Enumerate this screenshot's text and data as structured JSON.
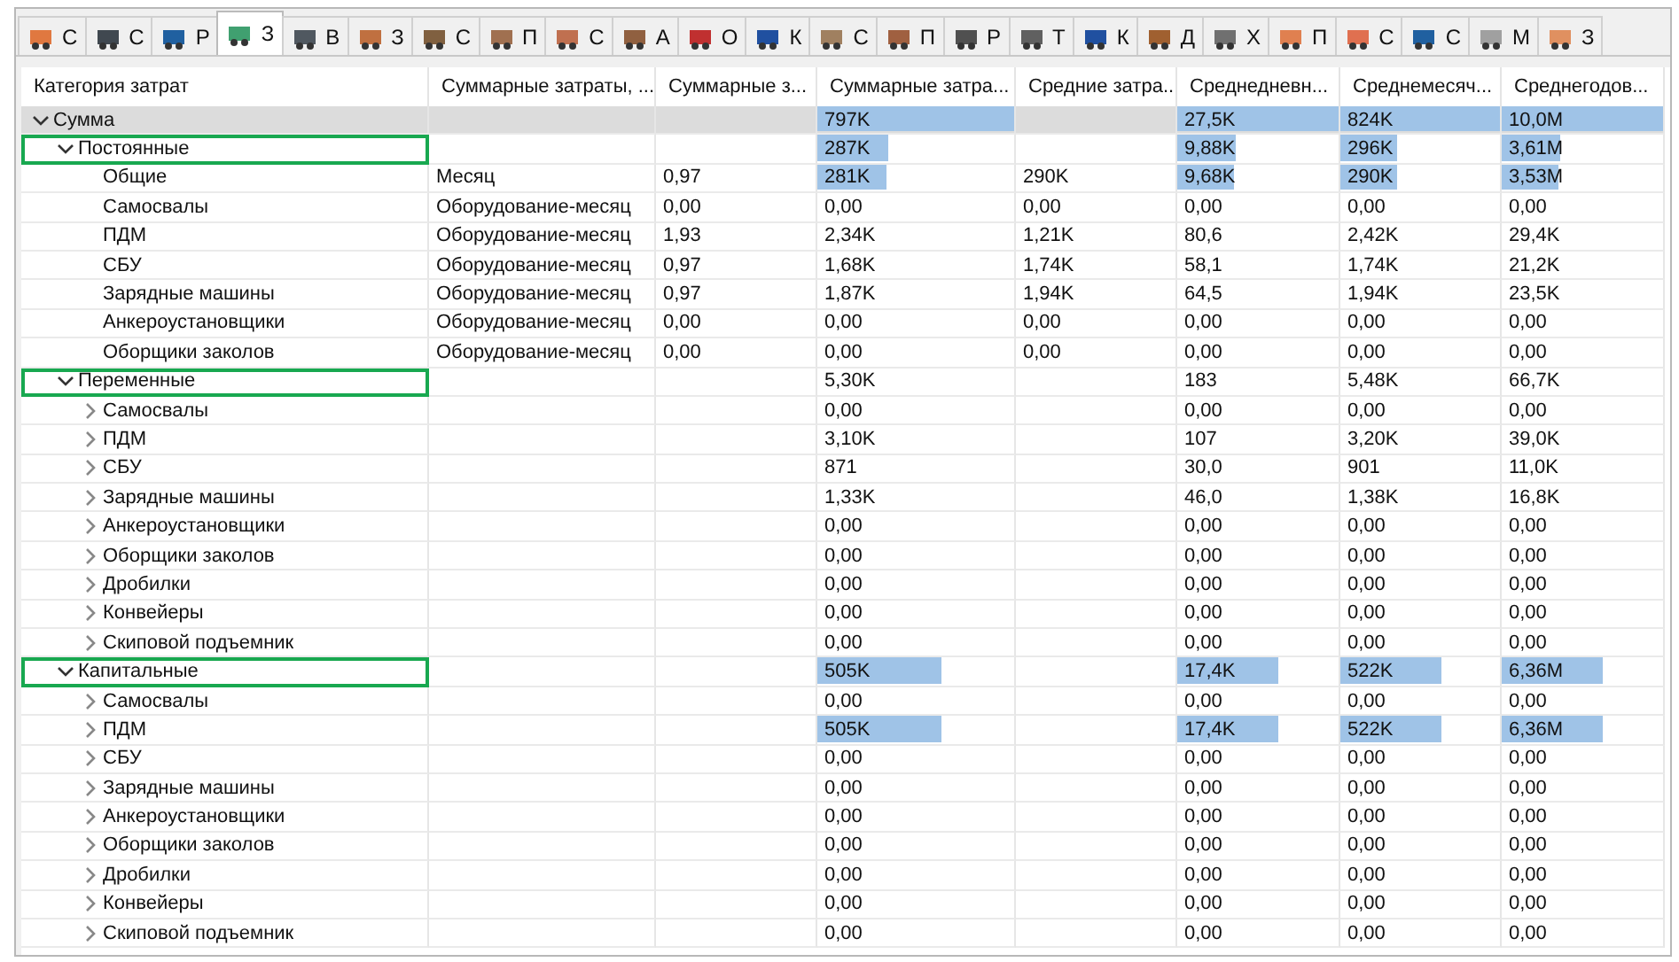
{
  "tabs": [
    {
      "label": "С",
      "selected": false
    },
    {
      "label": "С",
      "selected": false
    },
    {
      "label": "Р",
      "selected": false
    },
    {
      "label": "З",
      "selected": true
    },
    {
      "label": "В",
      "selected": false
    },
    {
      "label": "З",
      "selected": false
    },
    {
      "label": "С",
      "selected": false
    },
    {
      "label": "П",
      "selected": false
    },
    {
      "label": "С",
      "selected": false
    },
    {
      "label": "А",
      "selected": false
    },
    {
      "label": "О",
      "selected": false
    },
    {
      "label": "К",
      "selected": false
    },
    {
      "label": "С",
      "selected": false
    },
    {
      "label": "П",
      "selected": false
    },
    {
      "label": "Р",
      "selected": false
    },
    {
      "label": "Т",
      "selected": false
    },
    {
      "label": "К",
      "selected": false
    },
    {
      "label": "Д",
      "selected": false
    },
    {
      "label": "Х",
      "selected": false
    },
    {
      "label": "П",
      "selected": false
    },
    {
      "label": "С",
      "selected": false
    },
    {
      "label": "С",
      "selected": false
    },
    {
      "label": "М",
      "selected": false
    },
    {
      "label": "З",
      "selected": false
    }
  ],
  "table": {
    "columns": [
      "Категория затрат",
      "Суммарные затраты, ...",
      "Суммарные з...",
      "Суммарные затра...",
      "Средние затра...",
      "Среднедневн...",
      "Среднемесяч...",
      "Среднегодов..."
    ],
    "rows": [
      {
        "selected": true,
        "expanded": true,
        "highlighted": false,
        "cells": [
          {
            "text": "Сумма"
          },
          null,
          null,
          {
            "text": "797K",
            "level": 1
          },
          null,
          {
            "text": "27,5K",
            "level": 1
          },
          {
            "text": "824K",
            "level": 1
          },
          {
            "text": "10,0M",
            "level": 1
          }
        ],
        "children": [
          {
            "selected": false,
            "expanded": true,
            "highlighted": true,
            "cells": [
              {
                "text": "Постоянные"
              },
              null,
              null,
              {
                "text": "287K",
                "level": 0.36
              },
              null,
              {
                "text": "9,88K",
                "level": 0.36
              },
              {
                "text": "296K",
                "level": 0.36
              },
              {
                "text": "3,61M",
                "level": 0.36
              }
            ],
            "children": [
              {
                "selected": false,
                "cells": [
                  {
                    "text": "Общие"
                  },
                  {
                    "text": "Месяц"
                  },
                  {
                    "text": "0,97"
                  },
                  {
                    "text": "281K",
                    "level": 0.35
                  },
                  {
                    "text": "290K"
                  },
                  {
                    "text": "9,68K",
                    "level": 0.35
                  },
                  {
                    "text": "290K",
                    "level": 0.35
                  },
                  {
                    "text": "3,53M",
                    "level": 0.35
                  }
                ]
              },
              {
                "selected": false,
                "cells": [
                  {
                    "text": "Самосвалы"
                  },
                  {
                    "text": "Оборудование-месяц"
                  },
                  {
                    "text": "0,00"
                  },
                  {
                    "text": "0,00"
                  },
                  {
                    "text": "0,00"
                  },
                  {
                    "text": "0,00"
                  },
                  {
                    "text": "0,00"
                  },
                  {
                    "text": "0,00"
                  }
                ]
              },
              {
                "selected": false,
                "cells": [
                  {
                    "text": "ПДМ"
                  },
                  {
                    "text": "Оборудование-месяц"
                  },
                  {
                    "text": "1,93"
                  },
                  {
                    "text": "2,34K"
                  },
                  {
                    "text": "1,21K"
                  },
                  {
                    "text": "80,6"
                  },
                  {
                    "text": "2,42K"
                  },
                  {
                    "text": "29,4K"
                  }
                ]
              },
              {
                "selected": false,
                "cells": [
                  {
                    "text": "СБУ"
                  },
                  {
                    "text": "Оборудование-месяц"
                  },
                  {
                    "text": "0,97"
                  },
                  {
                    "text": "1,68K"
                  },
                  {
                    "text": "1,74K"
                  },
                  {
                    "text": "58,1"
                  },
                  {
                    "text": "1,74K"
                  },
                  {
                    "text": "21,2K"
                  }
                ]
              },
              {
                "selected": false,
                "cells": [
                  {
                    "text": "Зарядные машины"
                  },
                  {
                    "text": "Оборудование-месяц"
                  },
                  {
                    "text": "0,97"
                  },
                  {
                    "text": "1,87K"
                  },
                  {
                    "text": "1,94K"
                  },
                  {
                    "text": "64,5"
                  },
                  {
                    "text": "1,94K"
                  },
                  {
                    "text": "23,5K"
                  }
                ]
              },
              {
                "selected": false,
                "cells": [
                  {
                    "text": "Анкероустановщики"
                  },
                  {
                    "text": "Оборудование-месяц"
                  },
                  {
                    "text": "0,00"
                  },
                  {
                    "text": "0,00"
                  },
                  {
                    "text": "0,00"
                  },
                  {
                    "text": "0,00"
                  },
                  {
                    "text": "0,00"
                  },
                  {
                    "text": "0,00"
                  }
                ]
              },
              {
                "selected": false,
                "cells": [
                  {
                    "text": "Оборщики заколов"
                  },
                  {
                    "text": "Оборудование-месяц"
                  },
                  {
                    "text": "0,00"
                  },
                  {
                    "text": "0,00"
                  },
                  {
                    "text": "0,00"
                  },
                  {
                    "text": "0,00"
                  },
                  {
                    "text": "0,00"
                  },
                  {
                    "text": "0,00"
                  }
                ]
              }
            ]
          },
          {
            "selected": false,
            "expanded": true,
            "highlighted": true,
            "cells": [
              {
                "text": "Переменные"
              },
              null,
              null,
              {
                "text": "5,30K"
              },
              null,
              {
                "text": "183"
              },
              {
                "text": "5,48K"
              },
              {
                "text": "66,7K"
              }
            ],
            "children": [
              {
                "selected": false,
                "expanded": false,
                "cells": [
                  {
                    "text": "Самосвалы"
                  },
                  null,
                  null,
                  {
                    "text": "0,00"
                  },
                  null,
                  {
                    "text": "0,00"
                  },
                  {
                    "text": "0,00"
                  },
                  {
                    "text": "0,00"
                  }
                ]
              },
              {
                "selected": false,
                "expanded": false,
                "cells": [
                  {
                    "text": "ПДМ"
                  },
                  null,
                  null,
                  {
                    "text": "3,10K"
                  },
                  null,
                  {
                    "text": "107"
                  },
                  {
                    "text": "3,20K"
                  },
                  {
                    "text": "39,0K"
                  }
                ]
              },
              {
                "selected": false,
                "expanded": false,
                "cells": [
                  {
                    "text": "СБУ"
                  },
                  null,
                  null,
                  {
                    "text": "871"
                  },
                  null,
                  {
                    "text": "30,0"
                  },
                  {
                    "text": "901"
                  },
                  {
                    "text": "11,0K"
                  }
                ]
              },
              {
                "selected": false,
                "expanded": false,
                "cells": [
                  {
                    "text": "Зарядные машины"
                  },
                  null,
                  null,
                  {
                    "text": "1,33K"
                  },
                  null,
                  {
                    "text": "46,0"
                  },
                  {
                    "text": "1,38K"
                  },
                  {
                    "text": "16,8K"
                  }
                ]
              },
              {
                "selected": false,
                "expanded": false,
                "cells": [
                  {
                    "text": "Анкероустановщики"
                  },
                  null,
                  null,
                  {
                    "text": "0,00"
                  },
                  null,
                  {
                    "text": "0,00"
                  },
                  {
                    "text": "0,00"
                  },
                  {
                    "text": "0,00"
                  }
                ]
              },
              {
                "selected": false,
                "expanded": false,
                "cells": [
                  {
                    "text": "Оборщики заколов"
                  },
                  null,
                  null,
                  {
                    "text": "0,00"
                  },
                  null,
                  {
                    "text": "0,00"
                  },
                  {
                    "text": "0,00"
                  },
                  {
                    "text": "0,00"
                  }
                ]
              },
              {
                "selected": false,
                "expanded": false,
                "cells": [
                  {
                    "text": "Дробилки"
                  },
                  null,
                  null,
                  {
                    "text": "0,00"
                  },
                  null,
                  {
                    "text": "0,00"
                  },
                  {
                    "text": "0,00"
                  },
                  {
                    "text": "0,00"
                  }
                ]
              },
              {
                "selected": false,
                "expanded": false,
                "cells": [
                  {
                    "text": "Конвейеры"
                  },
                  null,
                  null,
                  {
                    "text": "0,00"
                  },
                  null,
                  {
                    "text": "0,00"
                  },
                  {
                    "text": "0,00"
                  },
                  {
                    "text": "0,00"
                  }
                ]
              },
              {
                "selected": false,
                "expanded": false,
                "cells": [
                  {
                    "text": "Скиповой подъемник"
                  },
                  null,
                  null,
                  {
                    "text": "0,00"
                  },
                  null,
                  {
                    "text": "0,00"
                  },
                  {
                    "text": "0,00"
                  },
                  {
                    "text": "0,00"
                  }
                ]
              }
            ]
          },
          {
            "selected": false,
            "expanded": true,
            "highlighted": true,
            "cells": [
              {
                "text": "Капитальные"
              },
              null,
              null,
              {
                "text": "505K",
                "level": 0.63
              },
              null,
              {
                "text": "17,4K",
                "level": 0.63
              },
              {
                "text": "522K",
                "level": 0.63
              },
              {
                "text": "6,36M",
                "level": 0.63
              }
            ],
            "children": [
              {
                "selected": false,
                "expanded": false,
                "cells": [
                  {
                    "text": "Самосвалы"
                  },
                  null,
                  null,
                  {
                    "text": "0,00"
                  },
                  null,
                  {
                    "text": "0,00"
                  },
                  {
                    "text": "0,00"
                  },
                  {
                    "text": "0,00"
                  }
                ]
              },
              {
                "selected": false,
                "expanded": false,
                "cells": [
                  {
                    "text": "ПДМ"
                  },
                  null,
                  null,
                  {
                    "text": "505K",
                    "level": 0.63
                  },
                  null,
                  {
                    "text": "17,4K",
                    "level": 0.63
                  },
                  {
                    "text": "522K",
                    "level": 0.63
                  },
                  {
                    "text": "6,36M",
                    "level": 0.63
                  }
                ]
              },
              {
                "selected": false,
                "expanded": false,
                "cells": [
                  {
                    "text": "СБУ"
                  },
                  null,
                  null,
                  {
                    "text": "0,00"
                  },
                  null,
                  {
                    "text": "0,00"
                  },
                  {
                    "text": "0,00"
                  },
                  {
                    "text": "0,00"
                  }
                ]
              },
              {
                "selected": false,
                "expanded": false,
                "cells": [
                  {
                    "text": "Зарядные машины"
                  },
                  null,
                  null,
                  {
                    "text": "0,00"
                  },
                  null,
                  {
                    "text": "0,00"
                  },
                  {
                    "text": "0,00"
                  },
                  {
                    "text": "0,00"
                  }
                ]
              },
              {
                "selected": false,
                "expanded": false,
                "cells": [
                  {
                    "text": "Анкероустановщики"
                  },
                  null,
                  null,
                  {
                    "text": "0,00"
                  },
                  null,
                  {
                    "text": "0,00"
                  },
                  {
                    "text": "0,00"
                  },
                  {
                    "text": "0,00"
                  }
                ]
              },
              {
                "selected": false,
                "expanded": false,
                "cells": [
                  {
                    "text": "Оборщики заколов"
                  },
                  null,
                  null,
                  {
                    "text": "0,00"
                  },
                  null,
                  {
                    "text": "0,00"
                  },
                  {
                    "text": "0,00"
                  },
                  {
                    "text": "0,00"
                  }
                ]
              },
              {
                "selected": false,
                "expanded": false,
                "cells": [
                  {
                    "text": "Дробилки"
                  },
                  null,
                  null,
                  {
                    "text": "0,00"
                  },
                  null,
                  {
                    "text": "0,00"
                  },
                  {
                    "text": "0,00"
                  },
                  {
                    "text": "0,00"
                  }
                ]
              },
              {
                "selected": false,
                "expanded": false,
                "cells": [
                  {
                    "text": "Конвейеры"
                  },
                  null,
                  null,
                  {
                    "text": "0,00"
                  },
                  null,
                  {
                    "text": "0,00"
                  },
                  {
                    "text": "0,00"
                  },
                  {
                    "text": "0,00"
                  }
                ]
              },
              {
                "selected": false,
                "expanded": false,
                "cells": [
                  {
                    "text": "Скиповой подъемник"
                  },
                  null,
                  null,
                  {
                    "text": "0,00"
                  },
                  null,
                  {
                    "text": "0,00"
                  },
                  {
                    "text": "0,00"
                  },
                  {
                    "text": "0,00"
                  }
                ]
              }
            ]
          }
        ]
      }
    ]
  }
}
